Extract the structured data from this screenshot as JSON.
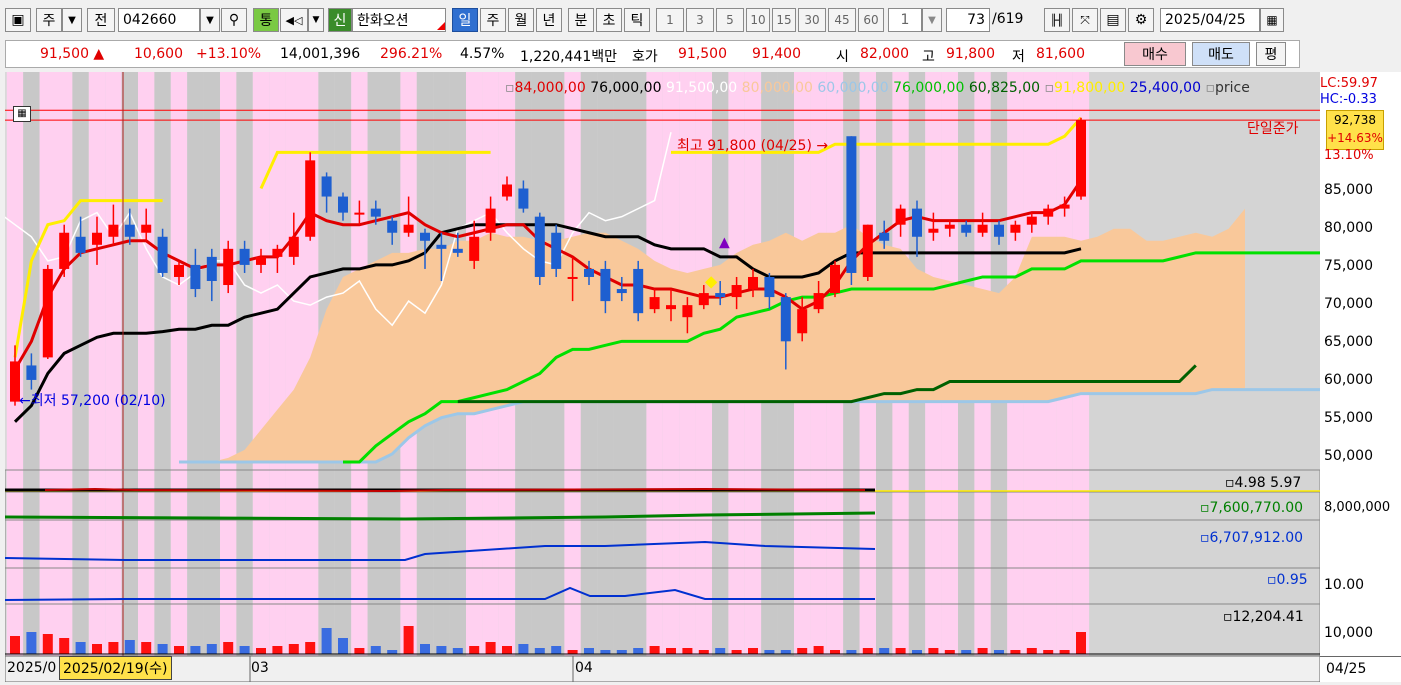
{
  "toolbar": {
    "market_type": "주",
    "prev_label": "전",
    "code": "042660",
    "search_icon": "magnifier",
    "tong_label": "통",
    "credit_label": "신",
    "stock_name": "한화오션",
    "periods": [
      "일",
      "주",
      "월",
      "년",
      "분",
      "초",
      "틱"
    ],
    "selected_period": "일",
    "minutes": [
      "1",
      "3",
      "5",
      "10",
      "15",
      "30",
      "45",
      "60"
    ],
    "multiplier": "1",
    "count": "73",
    "total": "/619",
    "date": "2025/04/25"
  },
  "quote": {
    "price": "91,500 ▲",
    "change": "10,600",
    "change_pct": "+13.10%",
    "volume": "14,001,396",
    "vol_ratio": "296.21%",
    "turnover": "4.57%",
    "amount": "1,220,441백만",
    "hoga_label": "호가",
    "ask": "91,500",
    "bid": "91,400",
    "open_label": "시",
    "open": "82,000",
    "high_label": "고",
    "high": "91,800",
    "low_label": "저",
    "low": "81,600",
    "buy_label": "매수",
    "sell_label": "매도",
    "eval_label": "평"
  },
  "legend": {
    "v1": "84,000,00",
    "v2": "76,000,00",
    "v3": "91,500,00",
    "v4": "80,000,00",
    "v5": "60,000,00",
    "v6": "76,000,00",
    "v7": "60,825,00",
    "v8": "91,800,00",
    "v9": "25,400,00",
    "v10": "price"
  },
  "annotations": {
    "max_label": "최고 91,800 (04/25) →",
    "min_label": "←최저 57,200 (02/10)",
    "limit_label": "단일준가",
    "lc": "LC:59.97",
    "hc": "HC:-0.33",
    "cur_price": "92,738",
    "cur_pct": "+14.63%",
    "pct_label": "13.10%"
  },
  "axis": {
    "price_ticks": [
      "85,000",
      "80,000",
      "75,000",
      "70,000",
      "65,000",
      "60,000",
      "55,000",
      "50,000"
    ],
    "sub1_val1": "4.98",
    "sub1_val2": "5.97",
    "sub2_val": "7,600,770.00",
    "sub2_tick": "8,000,000",
    "sub3_val": "6,707,912.00",
    "sub4_val": "0.95",
    "sub4_tick": "10.00",
    "sub5_val": "12,204.41",
    "sub5_tick": "10,000",
    "date_start": "2025/0",
    "cursor_date": "2025/02/19(수)",
    "month_03": "03",
    "month_04": "04",
    "date_end": "04/25"
  },
  "chart_data": {
    "type": "candlestick",
    "ylim": [
      48000,
      95000
    ],
    "candles": [
      {
        "o": 56500,
        "h": 63500,
        "l": 56000,
        "c": 61500
      },
      {
        "o": 61000,
        "h": 62500,
        "l": 58000,
        "c": 59200
      },
      {
        "o": 62000,
        "h": 73500,
        "l": 61800,
        "c": 73000
      },
      {
        "o": 73000,
        "h": 78500,
        "l": 72000,
        "c": 77500
      },
      {
        "o": 77000,
        "h": 79500,
        "l": 74500,
        "c": 75000
      },
      {
        "o": 76000,
        "h": 79500,
        "l": 73500,
        "c": 77500
      },
      {
        "o": 77000,
        "h": 81000,
        "l": 76000,
        "c": 78500
      },
      {
        "o": 78500,
        "h": 80500,
        "l": 76000,
        "c": 77000
      },
      {
        "o": 77500,
        "h": 80500,
        "l": 76500,
        "c": 78500
      },
      {
        "o": 77000,
        "h": 78000,
        "l": 72000,
        "c": 72500
      },
      {
        "o": 72000,
        "h": 74000,
        "l": 71000,
        "c": 73500
      },
      {
        "o": 73500,
        "h": 75500,
        "l": 69500,
        "c": 70500
      },
      {
        "o": 74500,
        "h": 75500,
        "l": 69000,
        "c": 71500
      },
      {
        "o": 71000,
        "h": 76500,
        "l": 70000,
        "c": 75500
      },
      {
        "o": 75500,
        "h": 76500,
        "l": 72500,
        "c": 73500
      },
      {
        "o": 73500,
        "h": 75500,
        "l": 72500,
        "c": 74500
      },
      {
        "o": 74500,
        "h": 76000,
        "l": 72500,
        "c": 75500
      },
      {
        "o": 74500,
        "h": 80000,
        "l": 73500,
        "c": 77000
      },
      {
        "o": 77000,
        "h": 87500,
        "l": 76500,
        "c": 86500
      },
      {
        "o": 84500,
        "h": 85000,
        "l": 80000,
        "c": 82000
      },
      {
        "o": 82000,
        "h": 82500,
        "l": 79000,
        "c": 80000
      },
      {
        "o": 80000,
        "h": 81500,
        "l": 78500,
        "c": 80000
      },
      {
        "o": 80500,
        "h": 81500,
        "l": 78500,
        "c": 79500
      },
      {
        "o": 79000,
        "h": 79500,
        "l": 76000,
        "c": 77500
      },
      {
        "o": 77500,
        "h": 82000,
        "l": 77000,
        "c": 78500
      },
      {
        "o": 77500,
        "h": 78000,
        "l": 73000,
        "c": 76500
      },
      {
        "o": 76000,
        "h": 77500,
        "l": 71500,
        "c": 75500
      },
      {
        "o": 75500,
        "h": 77500,
        "l": 74500,
        "c": 75000
      },
      {
        "o": 74000,
        "h": 79000,
        "l": 73000,
        "c": 77000
      },
      {
        "o": 77500,
        "h": 82000,
        "l": 76500,
        "c": 80500
      },
      {
        "o": 82000,
        "h": 84500,
        "l": 81500,
        "c": 83500
      },
      {
        "o": 83000,
        "h": 84000,
        "l": 80000,
        "c": 80500
      },
      {
        "o": 79500,
        "h": 80000,
        "l": 71000,
        "c": 72000
      },
      {
        "o": 77500,
        "h": 78500,
        "l": 72000,
        "c": 73000
      },
      {
        "o": 72000,
        "h": 74500,
        "l": 69000,
        "c": 72000
      },
      {
        "o": 73000,
        "h": 74000,
        "l": 71000,
        "c": 72000
      },
      {
        "o": 73000,
        "h": 74000,
        "l": 67500,
        "c": 69000
      },
      {
        "o": 70500,
        "h": 72000,
        "l": 69000,
        "c": 70000
      },
      {
        "o": 73000,
        "h": 74000,
        "l": 66500,
        "c": 67500
      },
      {
        "o": 68000,
        "h": 70500,
        "l": 67500,
        "c": 69500
      },
      {
        "o": 68000,
        "h": 70500,
        "l": 66500,
        "c": 68500
      },
      {
        "o": 67000,
        "h": 69500,
        "l": 65000,
        "c": 68500
      },
      {
        "o": 68500,
        "h": 71000,
        "l": 68000,
        "c": 70000
      },
      {
        "o": 70000,
        "h": 71500,
        "l": 68500,
        "c": 69500
      },
      {
        "o": 69500,
        "h": 72000,
        "l": 68000,
        "c": 71000
      },
      {
        "o": 70500,
        "h": 73000,
        "l": 69500,
        "c": 72000
      },
      {
        "o": 72000,
        "h": 72500,
        "l": 68000,
        "c": 69500
      },
      {
        "o": 69500,
        "h": 70000,
        "l": 60500,
        "c": 64000
      },
      {
        "o": 65000,
        "h": 69500,
        "l": 64000,
        "c": 68000
      },
      {
        "o": 68000,
        "h": 71500,
        "l": 67500,
        "c": 70000
      },
      {
        "o": 70000,
        "h": 74000,
        "l": 69500,
        "c": 73500
      },
      {
        "o": 89500,
        "h": 89500,
        "l": 71000,
        "c": 72500
      },
      {
        "o": 72000,
        "h": 78500,
        "l": 71500,
        "c": 78500
      },
      {
        "o": 77500,
        "h": 79000,
        "l": 75500,
        "c": 76500
      },
      {
        "o": 78500,
        "h": 81000,
        "l": 77000,
        "c": 80500
      },
      {
        "o": 80500,
        "h": 81500,
        "l": 74500,
        "c": 77000
      },
      {
        "o": 77500,
        "h": 80000,
        "l": 76500,
        "c": 78000
      },
      {
        "o": 78000,
        "h": 79000,
        "l": 77000,
        "c": 78500
      },
      {
        "o": 78500,
        "h": 79000,
        "l": 77000,
        "c": 77500
      },
      {
        "o": 77500,
        "h": 80000,
        "l": 77000,
        "c": 78500
      },
      {
        "o": 78500,
        "h": 79000,
        "l": 76000,
        "c": 77000
      },
      {
        "o": 77500,
        "h": 79000,
        "l": 76500,
        "c": 78500
      },
      {
        "o": 78500,
        "h": 80000,
        "l": 77500,
        "c": 79500
      },
      {
        "o": 79500,
        "h": 81000,
        "l": 78500,
        "c": 80500
      },
      {
        "o": 80500,
        "h": 82000,
        "l": 79500,
        "c": 81000
      },
      {
        "o": 82000,
        "h": 91800,
        "l": 81600,
        "c": 91500
      }
    ],
    "conversion": [
      54000,
      56000,
      60000,
      62500,
      63500,
      64500,
      65000,
      65000,
      65000,
      65200,
      65500,
      65500,
      66000,
      66000,
      67000,
      67500,
      68000,
      70000,
      72000,
      72500,
      73000,
      73000,
      73500,
      73500,
      74000,
      75000,
      77500,
      78000,
      78500,
      78500,
      78500,
      78500,
      78500,
      78500,
      78000,
      77500,
      77000,
      77000,
      77000,
      76000,
      75500,
      75500,
      75500,
      74500,
      74500,
      73000,
      72000,
      72000,
      72000,
      72500,
      74000,
      75000,
      75000,
      75000,
      75000,
      75000,
      75000,
      75000,
      75000,
      75000,
      75000,
      75000,
      75000,
      75000,
      75000,
      75500
    ],
    "base": [
      60500,
      64000,
      69500,
      73000,
      75000,
      75500,
      76000,
      76500,
      76500,
      75000,
      74000,
      73000,
      73500,
      73500,
      74000,
      74500,
      74500,
      77000,
      80000,
      79000,
      78500,
      78500,
      79000,
      79500,
      80000,
      78500,
      77500,
      77000,
      77500,
      78000,
      78500,
      78500,
      76500,
      75500,
      74500,
      73000,
      72000,
      71000,
      71000,
      70500,
      70500,
      70000,
      69500,
      69500,
      70000,
      70500,
      70500,
      69500,
      68000,
      69000,
      71000,
      74000,
      76000,
      77500,
      79000,
      79500,
      79000,
      79000,
      79000,
      79000,
      79000,
      79500,
      80000,
      80000,
      81000,
      84000
    ],
    "lagging": [
      80000,
      78500,
      77000,
      74000,
      74500,
      79000,
      80000,
      77000,
      80000,
      75500,
      72000,
      71000,
      72500,
      74000,
      74000,
      71000,
      70000,
      71000,
      69000,
      68500,
      69500,
      70000,
      71500,
      68000,
      66000,
      69000,
      67500,
      71000,
      78000,
      79000,
      80000,
      77500,
      75500,
      74000,
      73500,
      77500,
      80000,
      79000,
      79500,
      80500,
      81500,
      90000
    ],
    "span_a": [
      49000,
      49000,
      49000,
      49500,
      50500,
      53000,
      55500,
      58000,
      62000,
      68000,
      72000,
      73000,
      74000,
      75000,
      75000,
      75500,
      75500,
      76500,
      76500,
      77500,
      77000,
      77000,
      76500,
      76500,
      77000,
      77500,
      77500,
      76500,
      75500,
      74000,
      73000,
      72500,
      73000,
      73500,
      75000,
      76000,
      76500,
      77500,
      76500,
      77500,
      77500,
      78500,
      77000,
      76000,
      75500,
      73000,
      72000,
      71500,
      71000,
      70500,
      70000,
      72000,
      77000,
      77000,
      77000,
      76500,
      77000,
      78000,
      78000,
      76500,
      76500,
      77000,
      77500,
      77000,
      78000,
      80500
    ],
    "span_b": [
      49000,
      49000,
      49000,
      49000,
      49000,
      49000,
      49000,
      49000,
      49000,
      49000,
      49000,
      49000,
      49000,
      50000,
      52000,
      53500,
      54500,
      55000,
      55000,
      55500,
      56000,
      56500,
      56500,
      56500,
      56500,
      56500,
      56500,
      56500,
      56500,
      56500,
      56500,
      56500,
      56500,
      56500,
      56500,
      56500,
      56500,
      56500,
      56500,
      56500,
      56500,
      56500,
      56500,
      56500,
      56500,
      56500,
      56500,
      56500,
      56500,
      56500,
      56500,
      56500,
      56500,
      56500,
      57000,
      57500,
      57500,
      57500,
      57500,
      57500,
      57500,
      57500,
      57500,
      58000,
      58000,
      58000,
      58000,
      58000,
      58000,
      58000,
      58000,
      58000,
      58000,
      58000,
      58000,
      58000,
      58000,
      58000,
      58000,
      58000,
      58000,
      58000,
      59000,
      59000,
      59000,
      59000,
      59000,
      59000,
      59000,
      59500,
      59500
    ],
    "span_a_green": [
      49000,
      49000,
      51000,
      52500,
      54000,
      55000,
      56500,
      56500,
      57000,
      57500,
      58000,
      59000,
      60000,
      62000,
      63000,
      63000,
      63500,
      64000,
      64000,
      64000,
      64000,
      64000,
      65000,
      65500,
      67000,
      67500,
      68000,
      69000,
      69500,
      69500,
      70000,
      70500,
      70500,
      70500,
      70500,
      70500,
      70500,
      71000,
      71500,
      72000,
      72000,
      72000,
      73000,
      73000,
      73000,
      74000,
      74000,
      74000,
      74000,
      74000,
      74000,
      74500,
      75000,
      75000,
      75000,
      75000,
      75000,
      75000,
      75000,
      75000,
      75000,
      75000,
      75000,
      75000,
      75000,
      76000
    ],
    "span_b_dark": [
      56500,
      56500,
      56500,
      56500,
      56500,
      56500,
      56500,
      56500,
      56500,
      56500,
      56500,
      56500,
      56500,
      56500,
      56500,
      56500,
      56500,
      56500,
      56500,
      56500,
      56500,
      56500,
      56500,
      56500,
      56500,
      57000,
      57500,
      57500,
      58000,
      58000,
      59000,
      59000,
      59000,
      59000,
      59000,
      59000,
      59000,
      59000,
      59000,
      59000,
      59000,
      59000,
      59000,
      59000,
      59000,
      61000
    ]
  }
}
